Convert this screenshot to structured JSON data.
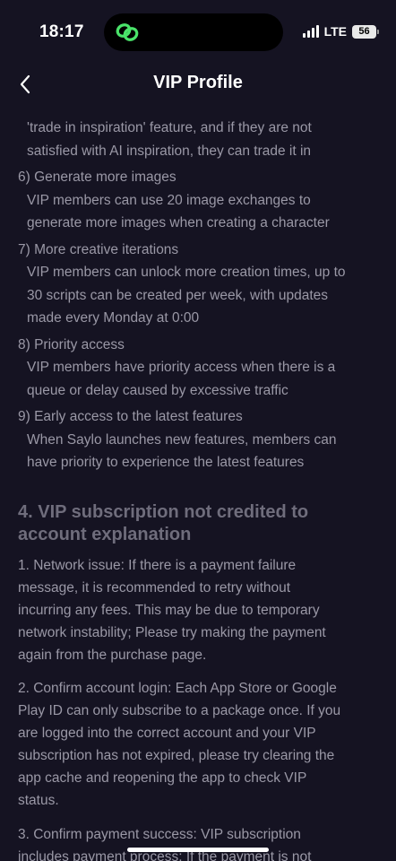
{
  "status_bar": {
    "time": "18:17",
    "network": "LTE",
    "battery": "56"
  },
  "nav": {
    "title": "VIP Profile"
  },
  "benefits": {
    "continued_lines": [
      "'trade in inspiration' feature, and if they are not",
      "satisfied with AI inspiration, they can trade it in"
    ],
    "items": [
      {
        "title": "6) Generate more images",
        "lines": [
          "VIP members can use 20 image exchanges to",
          "generate more images when creating a character"
        ]
      },
      {
        "title": "7) More creative iterations",
        "lines": [
          "VIP members can unlock more creation times, up to",
          "30 scripts can be created per week, with updates",
          "made every Monday at 0:00"
        ]
      },
      {
        "title": "8) Priority access",
        "lines": [
          "VIP members have priority access when there is a",
          "queue or delay caused by excessive traffic"
        ]
      },
      {
        "title": "9) Early access to the latest features",
        "lines": [
          "When Saylo launches new features, members can",
          "have priority to experience the latest features"
        ]
      }
    ]
  },
  "section4": {
    "title_lines": [
      "4. VIP subscription not credited to",
      "account explanation"
    ],
    "paragraphs": [
      {
        "lines": [
          "1. Network issue: If there is a payment failure",
          "message, it is recommended to retry without",
          "incurring any fees. This may be due to temporary",
          "network instability; Please try making the payment",
          "again from the purchase page."
        ]
      },
      {
        "lines": [
          "2. Confirm account login: Each App Store or Google",
          "Play ID can only subscribe to a package once. If you",
          "are logged into the correct account and your VIP",
          "subscription has not expired, please try clearing the",
          "app cache and reopening the app to check VIP",
          "status."
        ]
      },
      {
        "lines": [
          "3. Confirm payment success: VIP subscription",
          "includes payment process: If the payment is not"
        ]
      }
    ]
  }
}
